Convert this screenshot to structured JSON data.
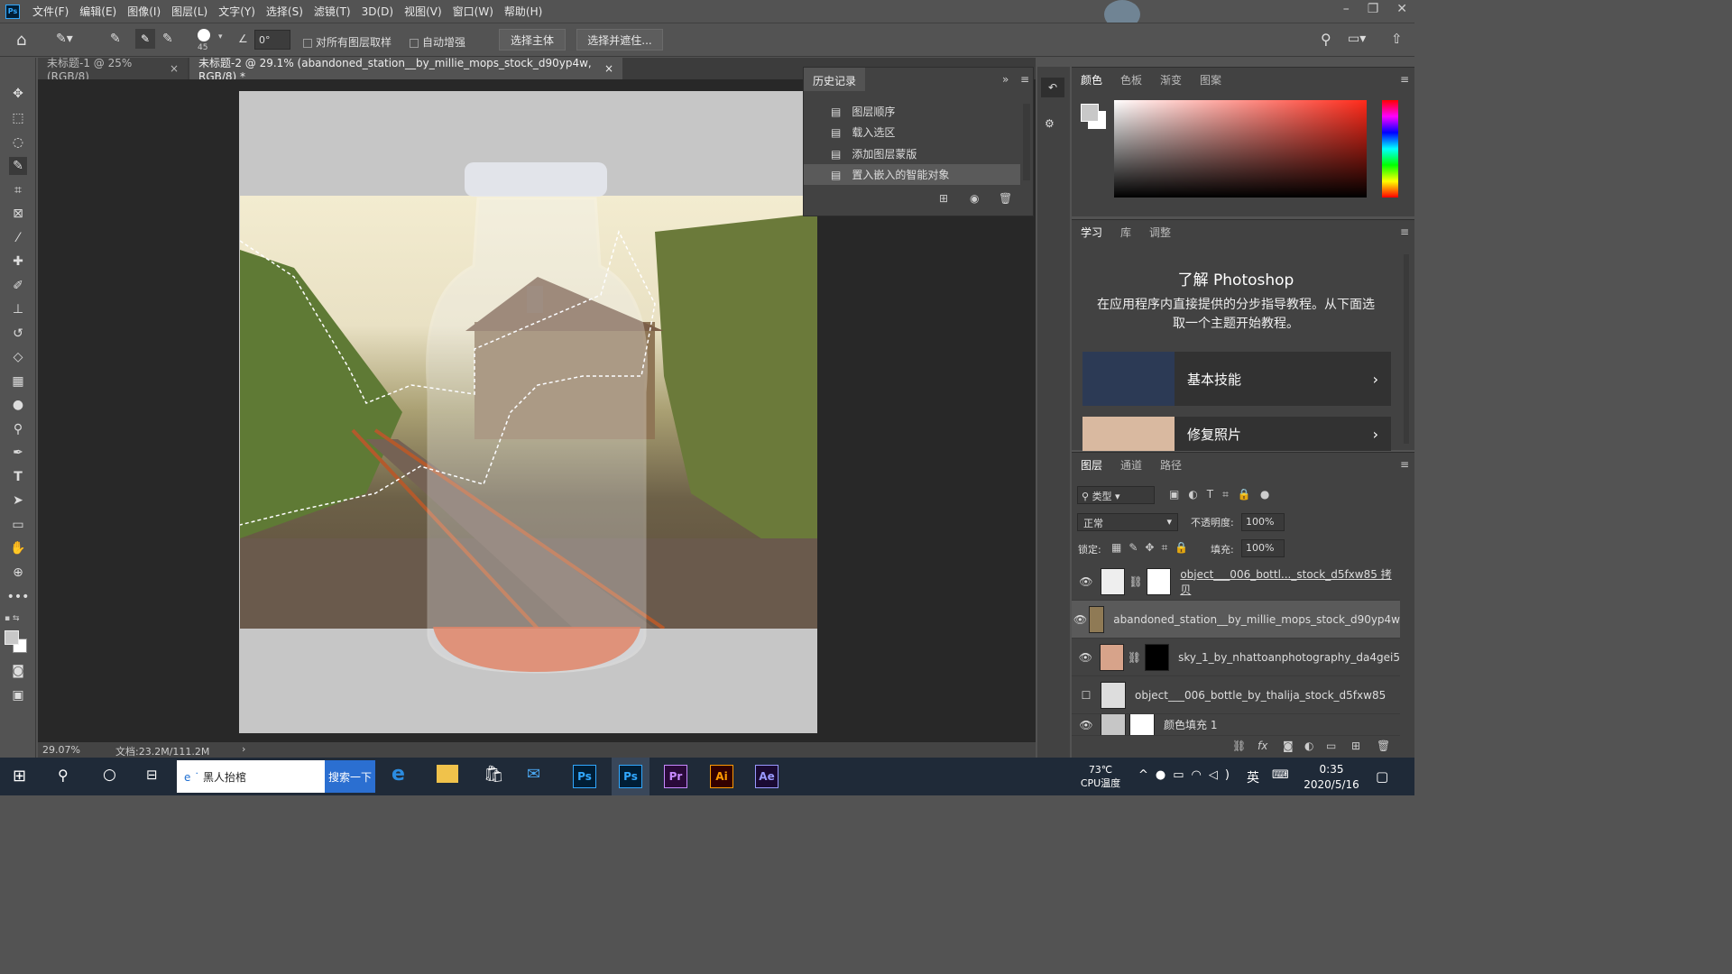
{
  "menu": {
    "items": [
      "文件(F)",
      "编辑(E)",
      "图像(I)",
      "图层(L)",
      "文字(Y)",
      "选择(S)",
      "滤镜(T)",
      "3D(D)",
      "视图(V)",
      "窗口(W)",
      "帮助(H)"
    ]
  },
  "options": {
    "brush_size": "45",
    "angle": "0°",
    "sample_all": "对所有图层取样",
    "auto_enhance": "自动增强",
    "select_subject": "选择主体",
    "select_mask": "选择并遮住..."
  },
  "tabs": [
    {
      "label": "未标题-1 @ 25%(RGB/8)"
    },
    {
      "label": "未标题-2 @ 29.1% (abandoned_station__by_millie_mops_stock_d90yp4w, RGB/8) *"
    }
  ],
  "status": {
    "zoom": "29.07%",
    "doc": "文档:23.2M/111.2M"
  },
  "history": {
    "title": "历史记录",
    "items": [
      "图层顺序",
      "载入选区",
      "添加图层蒙版",
      "置入嵌入的智能对象"
    ]
  },
  "color_panel": {
    "tabs": [
      "颜色",
      "色板",
      "渐变",
      "图案"
    ]
  },
  "learn_panel": {
    "tabs": [
      "学习",
      "库",
      "调整"
    ],
    "title": "了解 Photoshop",
    "desc": "在应用程序内直接提供的分步指导教程。从下面选取一个主题开始教程。",
    "cards": [
      "基本技能",
      "修复照片"
    ]
  },
  "layers_panel": {
    "tabs": [
      "图层",
      "通道",
      "路径"
    ],
    "filter": "类型",
    "blend": "正常",
    "opacity_label": "不透明度:",
    "opacity": "100%",
    "lock_label": "锁定:",
    "fill_label": "填充:",
    "fill": "100%",
    "layers": [
      "object___006_bottl..._stock_d5fxw85 拷贝",
      "abandoned_station__by_millie_mops_stock_d90yp4w",
      "sky_1_by_nhattoanphotography_da4gei5",
      "object___006_bottle_by_thalija_stock_d5fxw85",
      "颜色填充 1"
    ]
  },
  "taskbar": {
    "search_text": "黑人抬棺",
    "search_btn": "搜索一下",
    "temp": "73℃",
    "cpu": "CPU温度",
    "ime": "英",
    "time": "0:35",
    "date": "2020/5/16",
    "apps": [
      "Ps",
      "Ps",
      "Pr",
      "Ai",
      "Ae"
    ]
  }
}
